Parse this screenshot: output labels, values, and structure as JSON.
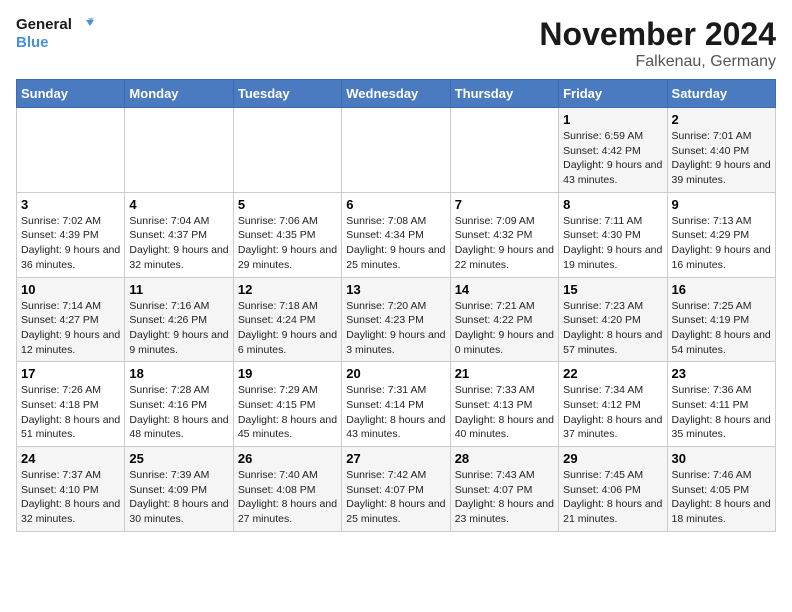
{
  "header": {
    "logo_general": "General",
    "logo_blue": "Blue",
    "month": "November 2024",
    "location": "Falkenau, Germany"
  },
  "weekdays": [
    "Sunday",
    "Monday",
    "Tuesday",
    "Wednesday",
    "Thursday",
    "Friday",
    "Saturday"
  ],
  "weeks": [
    [
      {
        "day": "",
        "info": ""
      },
      {
        "day": "",
        "info": ""
      },
      {
        "day": "",
        "info": ""
      },
      {
        "day": "",
        "info": ""
      },
      {
        "day": "",
        "info": ""
      },
      {
        "day": "1",
        "info": "Sunrise: 6:59 AM\nSunset: 4:42 PM\nDaylight: 9 hours and 43 minutes."
      },
      {
        "day": "2",
        "info": "Sunrise: 7:01 AM\nSunset: 4:40 PM\nDaylight: 9 hours and 39 minutes."
      }
    ],
    [
      {
        "day": "3",
        "info": "Sunrise: 7:02 AM\nSunset: 4:39 PM\nDaylight: 9 hours and 36 minutes."
      },
      {
        "day": "4",
        "info": "Sunrise: 7:04 AM\nSunset: 4:37 PM\nDaylight: 9 hours and 32 minutes."
      },
      {
        "day": "5",
        "info": "Sunrise: 7:06 AM\nSunset: 4:35 PM\nDaylight: 9 hours and 29 minutes."
      },
      {
        "day": "6",
        "info": "Sunrise: 7:08 AM\nSunset: 4:34 PM\nDaylight: 9 hours and 25 minutes."
      },
      {
        "day": "7",
        "info": "Sunrise: 7:09 AM\nSunset: 4:32 PM\nDaylight: 9 hours and 22 minutes."
      },
      {
        "day": "8",
        "info": "Sunrise: 7:11 AM\nSunset: 4:30 PM\nDaylight: 9 hours and 19 minutes."
      },
      {
        "day": "9",
        "info": "Sunrise: 7:13 AM\nSunset: 4:29 PM\nDaylight: 9 hours and 16 minutes."
      }
    ],
    [
      {
        "day": "10",
        "info": "Sunrise: 7:14 AM\nSunset: 4:27 PM\nDaylight: 9 hours and 12 minutes."
      },
      {
        "day": "11",
        "info": "Sunrise: 7:16 AM\nSunset: 4:26 PM\nDaylight: 9 hours and 9 minutes."
      },
      {
        "day": "12",
        "info": "Sunrise: 7:18 AM\nSunset: 4:24 PM\nDaylight: 9 hours and 6 minutes."
      },
      {
        "day": "13",
        "info": "Sunrise: 7:20 AM\nSunset: 4:23 PM\nDaylight: 9 hours and 3 minutes."
      },
      {
        "day": "14",
        "info": "Sunrise: 7:21 AM\nSunset: 4:22 PM\nDaylight: 9 hours and 0 minutes."
      },
      {
        "day": "15",
        "info": "Sunrise: 7:23 AM\nSunset: 4:20 PM\nDaylight: 8 hours and 57 minutes."
      },
      {
        "day": "16",
        "info": "Sunrise: 7:25 AM\nSunset: 4:19 PM\nDaylight: 8 hours and 54 minutes."
      }
    ],
    [
      {
        "day": "17",
        "info": "Sunrise: 7:26 AM\nSunset: 4:18 PM\nDaylight: 8 hours and 51 minutes."
      },
      {
        "day": "18",
        "info": "Sunrise: 7:28 AM\nSunset: 4:16 PM\nDaylight: 8 hours and 48 minutes."
      },
      {
        "day": "19",
        "info": "Sunrise: 7:29 AM\nSunset: 4:15 PM\nDaylight: 8 hours and 45 minutes."
      },
      {
        "day": "20",
        "info": "Sunrise: 7:31 AM\nSunset: 4:14 PM\nDaylight: 8 hours and 43 minutes."
      },
      {
        "day": "21",
        "info": "Sunrise: 7:33 AM\nSunset: 4:13 PM\nDaylight: 8 hours and 40 minutes."
      },
      {
        "day": "22",
        "info": "Sunrise: 7:34 AM\nSunset: 4:12 PM\nDaylight: 8 hours and 37 minutes."
      },
      {
        "day": "23",
        "info": "Sunrise: 7:36 AM\nSunset: 4:11 PM\nDaylight: 8 hours and 35 minutes."
      }
    ],
    [
      {
        "day": "24",
        "info": "Sunrise: 7:37 AM\nSunset: 4:10 PM\nDaylight: 8 hours and 32 minutes."
      },
      {
        "day": "25",
        "info": "Sunrise: 7:39 AM\nSunset: 4:09 PM\nDaylight: 8 hours and 30 minutes."
      },
      {
        "day": "26",
        "info": "Sunrise: 7:40 AM\nSunset: 4:08 PM\nDaylight: 8 hours and 27 minutes."
      },
      {
        "day": "27",
        "info": "Sunrise: 7:42 AM\nSunset: 4:07 PM\nDaylight: 8 hours and 25 minutes."
      },
      {
        "day": "28",
        "info": "Sunrise: 7:43 AM\nSunset: 4:07 PM\nDaylight: 8 hours and 23 minutes."
      },
      {
        "day": "29",
        "info": "Sunrise: 7:45 AM\nSunset: 4:06 PM\nDaylight: 8 hours and 21 minutes."
      },
      {
        "day": "30",
        "info": "Sunrise: 7:46 AM\nSunset: 4:05 PM\nDaylight: 8 hours and 18 minutes."
      }
    ]
  ]
}
